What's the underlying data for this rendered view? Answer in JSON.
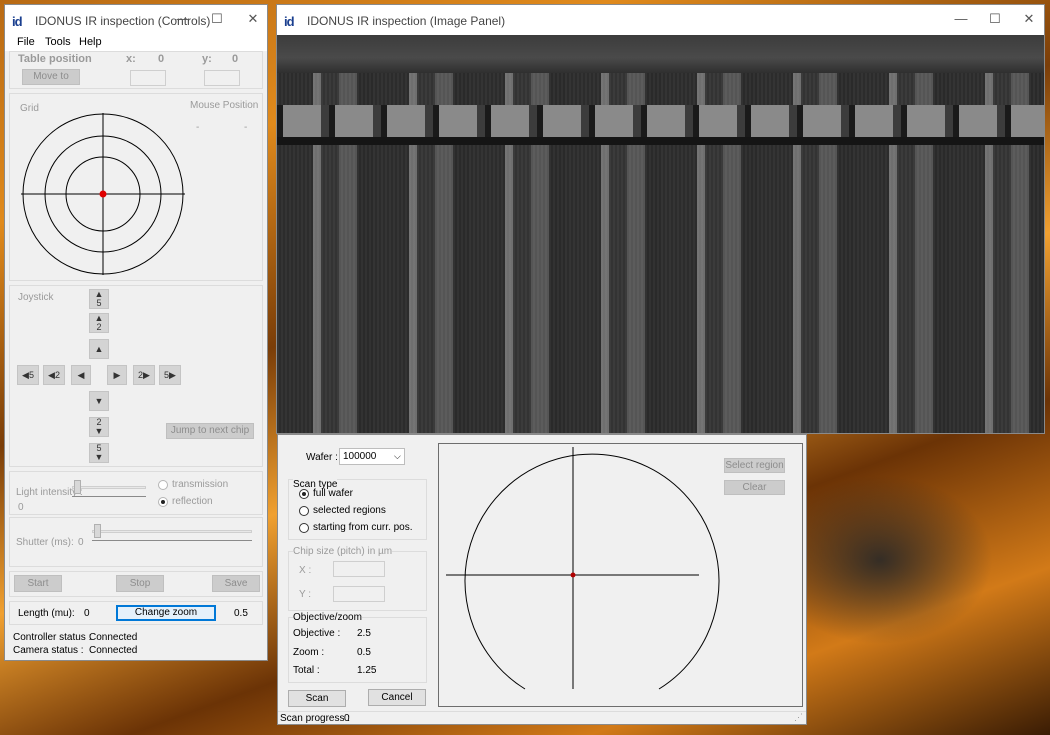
{
  "controls_window": {
    "logo": "id",
    "title": "IDONUS IR inspection (Controls)",
    "menu": [
      "File",
      "Tools",
      "Help"
    ],
    "table_position": {
      "label": "Table position",
      "x_label": "x:",
      "x_value": "0",
      "y_label": "y:",
      "y_value": "0",
      "move_button": "Move to"
    },
    "grid": {
      "label": "Grid",
      "mouse_position_label": "Mouse Position",
      "mouse_x": "-",
      "mouse_y": "-"
    },
    "joystick": {
      "label": "Joystick",
      "up5": "5",
      "up2": "2",
      "down2": "2",
      "down5": "5",
      "left5": "5",
      "left2": "2",
      "right2": "2",
      "right5": "5",
      "jump_button": "Jump to next chip"
    },
    "light": {
      "label": "Light intensity :",
      "value": "0",
      "transmission": "transmission",
      "reflection": "reflection"
    },
    "shutter": {
      "label": "Shutter (ms):",
      "value": "0"
    },
    "actions": {
      "start": "Start",
      "stop": "Stop",
      "save": "Save"
    },
    "length": {
      "label": "Length (mu):",
      "value": "0",
      "zoom_button": "Change zoom",
      "zoom_value": "0.5"
    },
    "status": {
      "controller_label": "Controller status :",
      "controller_value": "Connected",
      "camera_label": "Camera status :",
      "camera_value": "Connected"
    }
  },
  "image_window": {
    "logo": "id",
    "title": "IDONUS IR inspection (Image Panel)"
  },
  "scan_panel": {
    "wafer_label": "Wafer :",
    "wafer_value": "100000",
    "scan_type": {
      "label": "Scan type",
      "options": [
        "full wafer",
        "selected regions",
        "starting from curr. pos."
      ],
      "selected": 0
    },
    "chip_size": {
      "label": "Chip size (pitch) in µm",
      "x_label": "X :",
      "y_label": "Y :"
    },
    "objective": {
      "label": "Objective/zoom",
      "objective_label": "Objective :",
      "objective_value": "2.5",
      "zoom_label": "Zoom :",
      "zoom_value": "0.5",
      "total_label": "Total :",
      "total_value": "1.25"
    },
    "scan_button": "Scan",
    "cancel_button": "Cancel",
    "select_region_button": "Select region",
    "clear_button": "Clear",
    "progress_label": "Scan progress :",
    "progress_value": "0"
  },
  "colors": {
    "marker": "#e00000",
    "focus": "#0078d7",
    "logo": "#1a3f8f"
  }
}
